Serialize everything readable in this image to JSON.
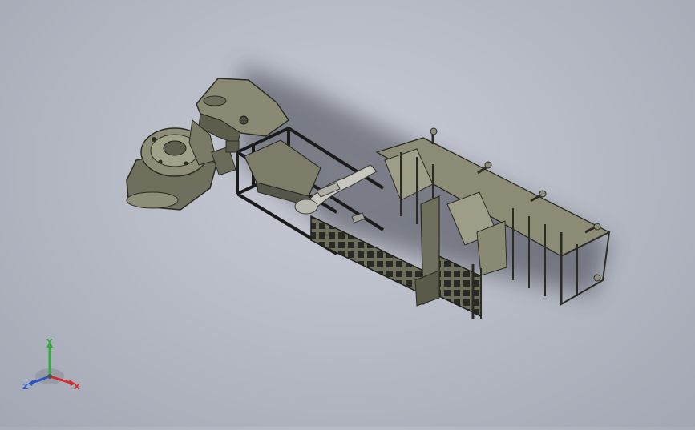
{
  "triad": {
    "x_label": "X",
    "y_label": "Y",
    "z_label": "Z",
    "x_color": "#d42a2a",
    "y_color": "#2fae3a",
    "z_color": "#2a54c8"
  },
  "model": {
    "part_color": "#7a7a66",
    "part_dark": "#4b4b3e",
    "frame_color": "#1e1e1e",
    "shadow_color": "#3c3f49"
  }
}
